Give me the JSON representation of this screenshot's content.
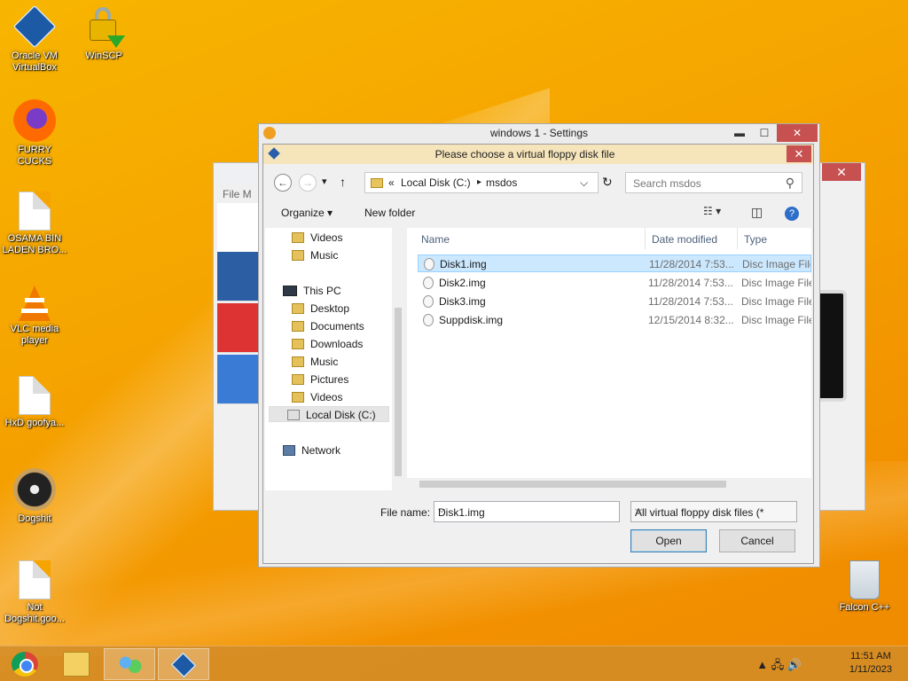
{
  "desktop": {
    "icons": [
      {
        "label": "Oracle VM VirtualBox"
      },
      {
        "label": "WinSCP"
      },
      {
        "label": "FURRY CUCKS"
      },
      {
        "label": "OSAMA BIN LADEN BRO..."
      },
      {
        "label": "VLC media player"
      },
      {
        "label": "HxD goofya..."
      },
      {
        "label": "Dogshit"
      },
      {
        "label": "Not Dogshit.goo..."
      },
      {
        "label": "Falcon C++"
      }
    ]
  },
  "background_window": {
    "menu": "File   M",
    "close": "✕"
  },
  "settings_window": {
    "title": "windows 1 - Settings",
    "min": "▬",
    "max": "☐",
    "close": "✕"
  },
  "dialog": {
    "title": "Please choose a virtual floppy disk file",
    "close": "✕",
    "nav": {
      "back": "←",
      "forward": "→",
      "recent": "▾",
      "up": "↑",
      "address": {
        "prefix": "«",
        "root": "Local Disk (C:)",
        "sep": "▸",
        "folder": "msdos",
        "dropdown": "⌵",
        "refresh": "↻"
      },
      "search_placeholder": "Search msdos",
      "search_icon": "⚲"
    },
    "toolbar": {
      "organize": "Organize ▾",
      "new_folder": "New folder",
      "view_icon": "☷ ▾",
      "pane_icon": "◫",
      "help_icon": "?"
    },
    "nav_pane": {
      "items": [
        "Videos",
        "Music",
        "This PC",
        "Desktop",
        "Documents",
        "Downloads",
        "Music",
        "Pictures",
        "Videos",
        "Local Disk (C:)",
        "Network"
      ]
    },
    "columns": {
      "name": "Name",
      "date": "Date modified",
      "type": "Type"
    },
    "files": [
      {
        "name": "Disk1.img",
        "date": "11/28/2014 7:53...",
        "type": "Disc Image File"
      },
      {
        "name": "Disk2.img",
        "date": "11/28/2014 7:53...",
        "type": "Disc Image File"
      },
      {
        "name": "Disk3.img",
        "date": "11/28/2014 7:53...",
        "type": "Disc Image File"
      },
      {
        "name": "Suppdisk.img",
        "date": "12/15/2014 8:32...",
        "type": "Disc Image File"
      }
    ],
    "file_name_label": "File name:",
    "file_name_value": "Disk1.img",
    "file_type": "All virtual floppy disk files (*",
    "open": "Open",
    "cancel": "Cancel"
  },
  "taskbar": {
    "tray_icons": "▲  🖧  🔊",
    "time": "11:51 AM",
    "date": "1/11/2023"
  }
}
